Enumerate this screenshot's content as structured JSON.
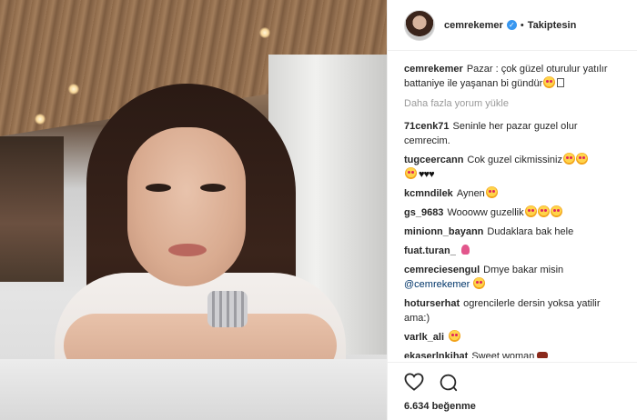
{
  "post": {
    "username": "cemrekemer",
    "follow_status": "Takiptesin",
    "caption_user": "cemrekemer",
    "caption_text": "Pazar : çok güzel oturulur yatılır battaniye ile yaşanan bi gündür",
    "load_more": "Daha fazla yorum yükle",
    "likes": "6.634 beğenme"
  },
  "comments": [
    {
      "user": "71cenk71",
      "text": "Seninle her pazar guzel olur cemrecim."
    },
    {
      "user": "tugceercann",
      "text": "Cok guzel cikmissiniz"
    },
    {
      "user": "kcmndilek",
      "text": "Aynen"
    },
    {
      "user": "gs_9683",
      "text": "Woooww guzellik"
    },
    {
      "user": "minionn_bayann",
      "text": "Dudaklara bak hele"
    },
    {
      "user": "fuat.turan_",
      "text": ""
    },
    {
      "user": "cemreciesengul",
      "text": "Dmye bakar misin",
      "mention": "@cemrekemer"
    },
    {
      "user": "hoturserhat",
      "text": "ogrencilerle dersin yoksa yatilir ama:)"
    },
    {
      "user": "varlk_ali",
      "text": ""
    },
    {
      "user": "ekaserlnkihat",
      "text": "Sweet woman"
    }
  ],
  "icons": [
    "heart-icon",
    "comment-icon",
    "verified-badge-icon"
  ],
  "colors": {
    "verified": "#3897f0",
    "text": "#262626",
    "muted": "#999999",
    "mention": "#003569"
  }
}
